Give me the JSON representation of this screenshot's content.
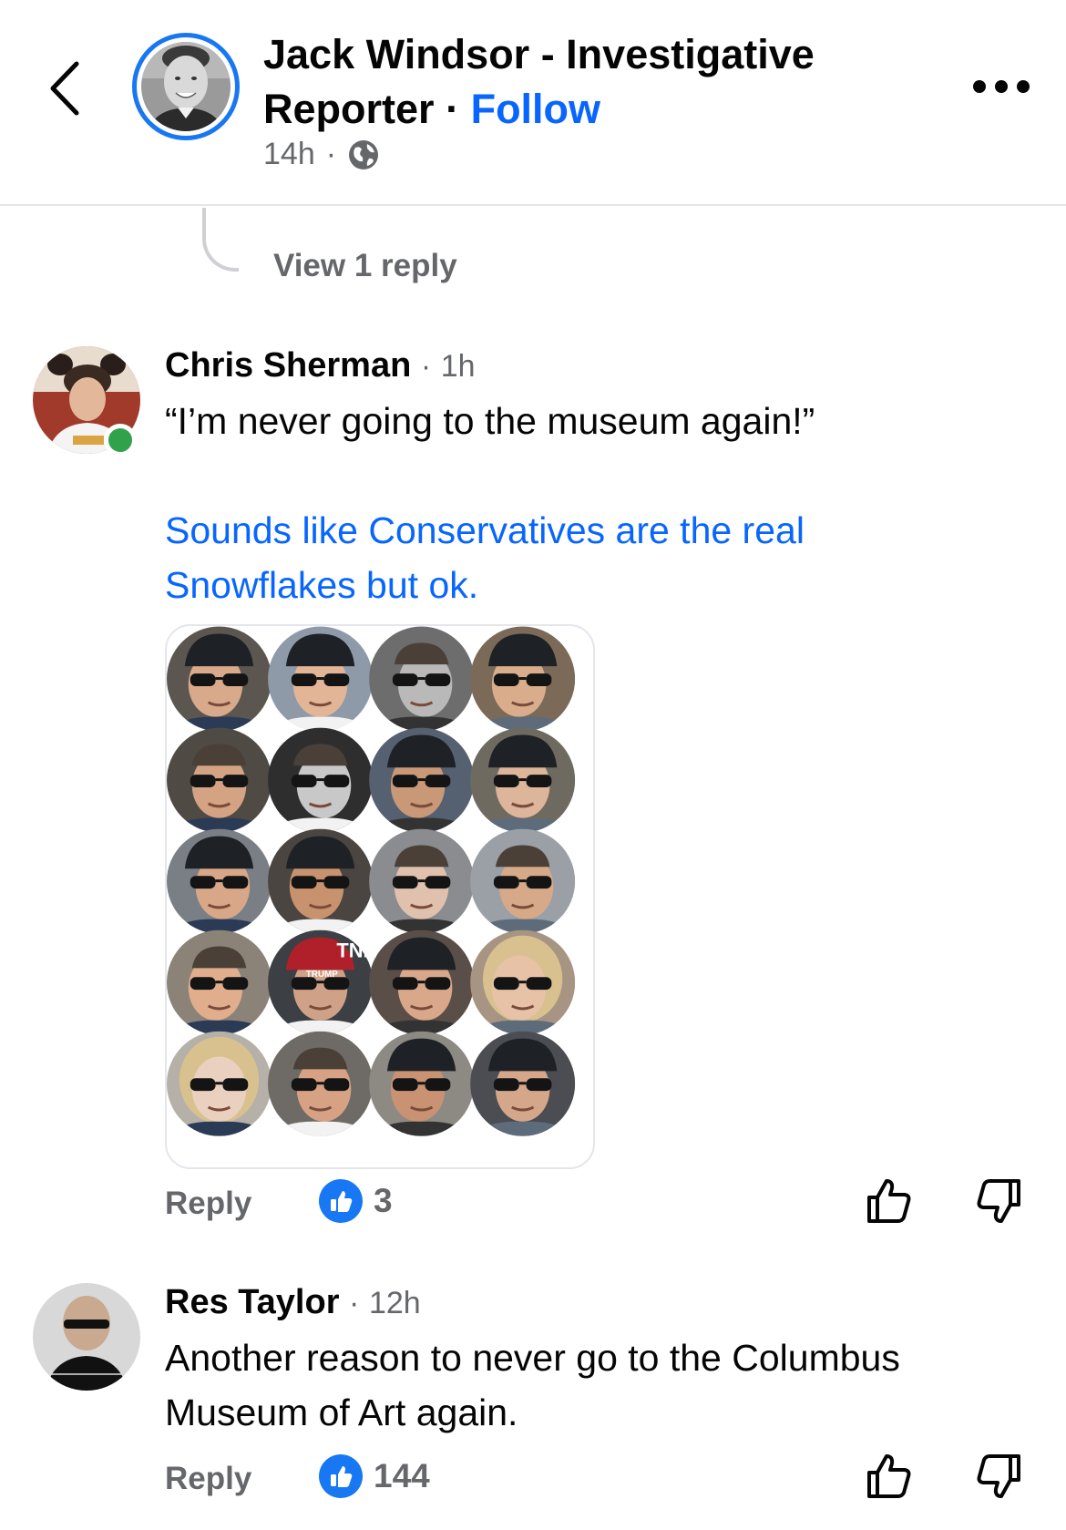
{
  "header": {
    "author_name": "Jack Windsor - Investigative Reporter",
    "separator": "·",
    "follow_label": "Follow",
    "time": "14h",
    "meta_separator": "·",
    "privacy_icon": "globe-icon",
    "back_icon": "chevron-left-icon",
    "more_icon": "more-horizontal-icon"
  },
  "thread": {
    "view_reply_label": "View 1 reply"
  },
  "comments": [
    {
      "author": "Chris Sherman",
      "time": "1h",
      "separator": "·",
      "text": "“I’m never going to the museum again!”",
      "link_text": "Sounds like Conservatives are the real Snowflakes but ok.",
      "has_image": true,
      "online": true,
      "reply_label": "Reply",
      "reaction_icon": "like-icon",
      "reaction_count": "3"
    },
    {
      "author": "Res Taylor",
      "time": "12h",
      "separator": "·",
      "text": "Another reason to never go to the Columbus Museum of Art again.",
      "has_image": false,
      "online": false,
      "reply_label": "Reply",
      "reaction_icon": "like-icon",
      "reaction_count": "144"
    }
  ],
  "image_collage": {
    "overlay_texts": [
      "TNN",
      "TRUMP"
    ]
  },
  "colors": {
    "accent": "#1877f2",
    "link": "#0866ff",
    "secondary_text": "#65676b",
    "online": "#31a24c",
    "divider": "#e4e6eb"
  }
}
